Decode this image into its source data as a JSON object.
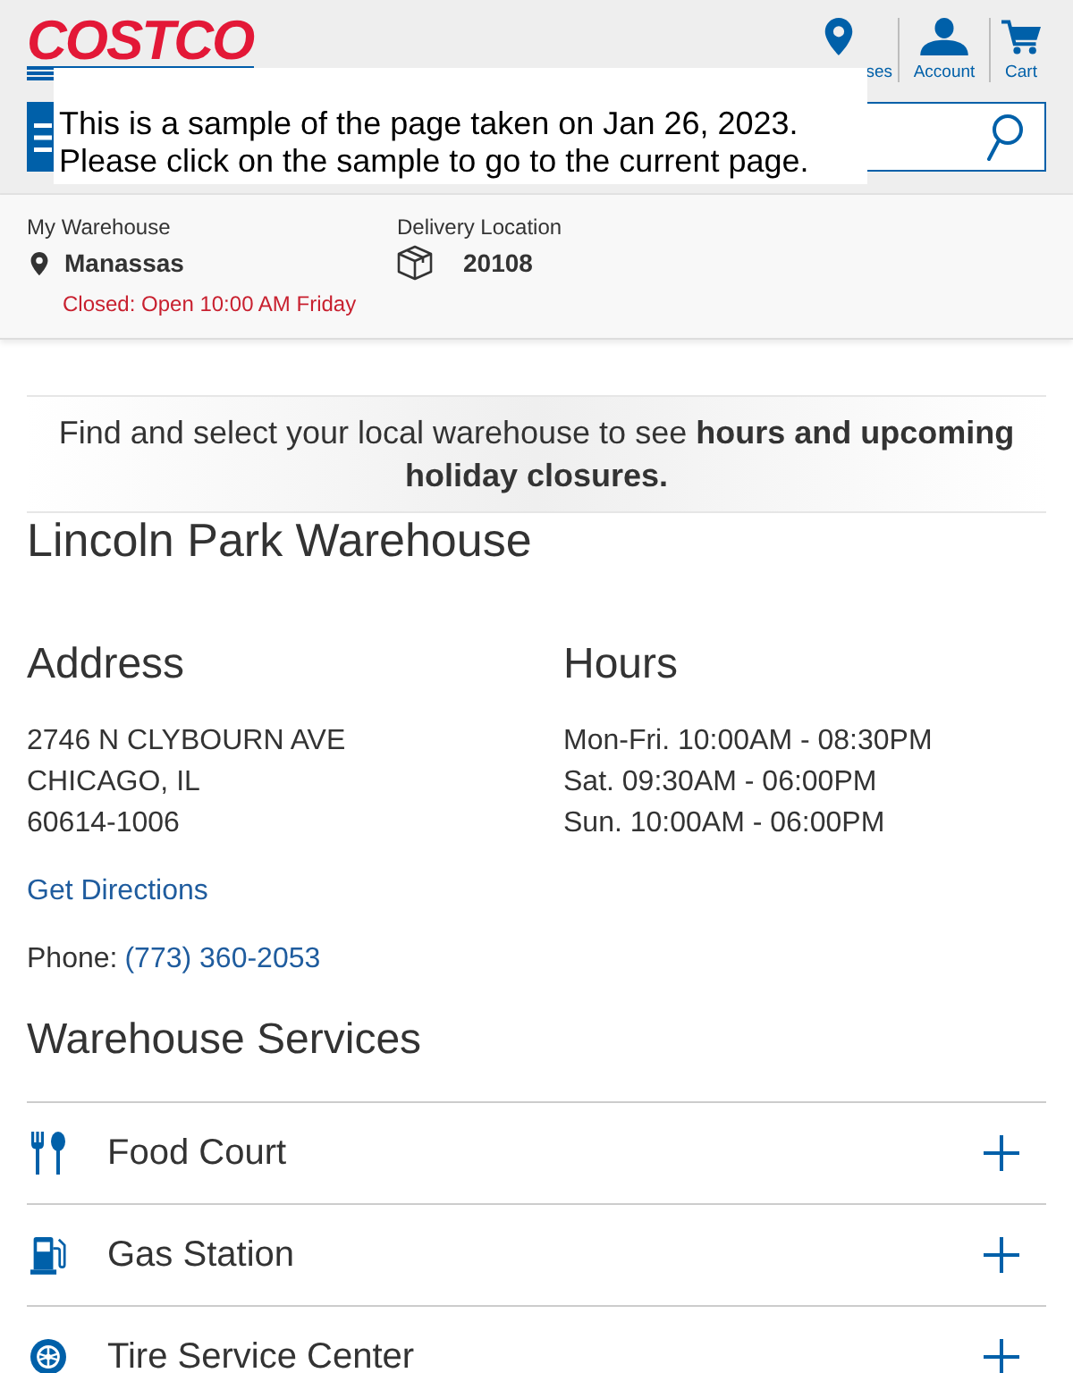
{
  "header": {
    "logo": "COSTCO",
    "nav": [
      {
        "kind": "location",
        "label": "ses"
      },
      {
        "kind": "account",
        "label": "Account"
      },
      {
        "kind": "cart",
        "label": "Cart"
      }
    ]
  },
  "notice": {
    "lines": [
      "This is a sample of the page taken on Jan 26, 2023.",
      "Please click on the sample to go to the current page."
    ]
  },
  "warehouse_bar": {
    "my_warehouse": {
      "label": "My Warehouse",
      "name": "Manassas",
      "status": "Closed: Open 10:00 AM Friday"
    },
    "delivery": {
      "label": "Delivery Location",
      "zip": "20108"
    }
  },
  "info_message": "Find and select your local warehouse to see **hours and upcoming holiday closures.**",
  "warehouse": {
    "title": "Lincoln Park Warehouse",
    "address": {
      "heading": "Address",
      "lines": [
        "2746 N CLYBOURN AVE",
        "CHICAGO, IL",
        "60614-1006"
      ]
    },
    "hours": {
      "heading": "Hours",
      "lines": [
        "Mon-Fri. 10:00AM - 08:30PM",
        "Sat. 09:30AM - 06:00PM",
        "Sun. 10:00AM - 06:00PM"
      ]
    },
    "directions_link": "Get Directions",
    "phone": {
      "label": "Phone:",
      "number": "(773) 360-2053"
    }
  },
  "services": {
    "heading": "Warehouse Services",
    "items": [
      {
        "kind": "food",
        "label": "Food Court",
        "expanded": false
      },
      {
        "kind": "gas",
        "label": "Gas Station",
        "expanded": false
      },
      {
        "kind": "tire",
        "label": "Tire Service Center",
        "expanded": false
      }
    ]
  }
}
